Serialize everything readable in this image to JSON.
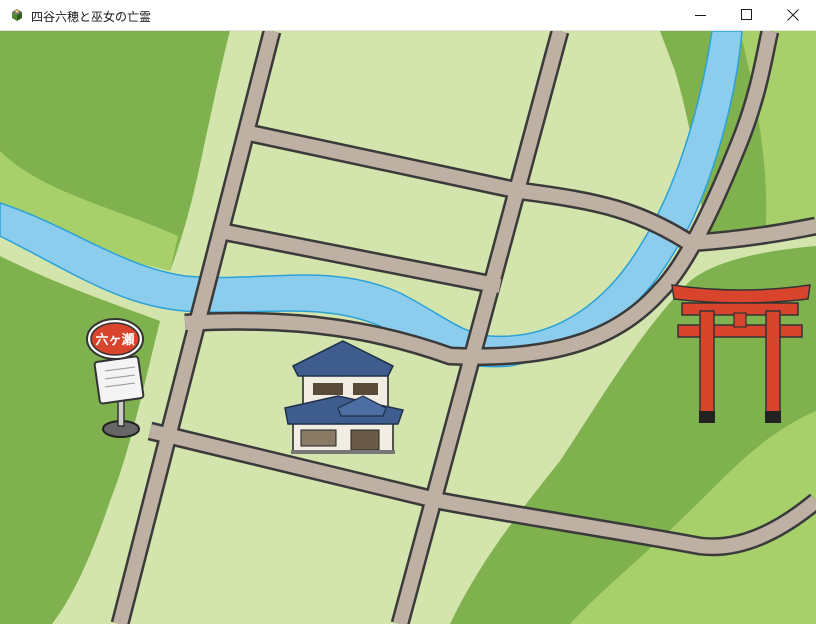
{
  "window": {
    "title": "四谷六穂と巫女の亡霊",
    "controls": {
      "minimize": "minimize",
      "maximize": "maximize",
      "close": "close"
    }
  },
  "map": {
    "colors": {
      "forest_dark": "#7fb24e",
      "forest_light": "#a7cf6a",
      "field": "#d4e4ad",
      "road_fill": "#beb0a2",
      "road_edge": "#3a3a3a",
      "river": "#8ccdee",
      "river_edge": "#2aa2d8",
      "torii_red": "#d8442c"
    },
    "landmarks": {
      "bus_stop": {
        "icon": "bus-stop-sign-icon",
        "sign_text": "六ヶ瀬"
      },
      "house": {
        "icon": "japanese-house-icon"
      },
      "torii": {
        "icon": "torii-gate-icon"
      }
    }
  }
}
